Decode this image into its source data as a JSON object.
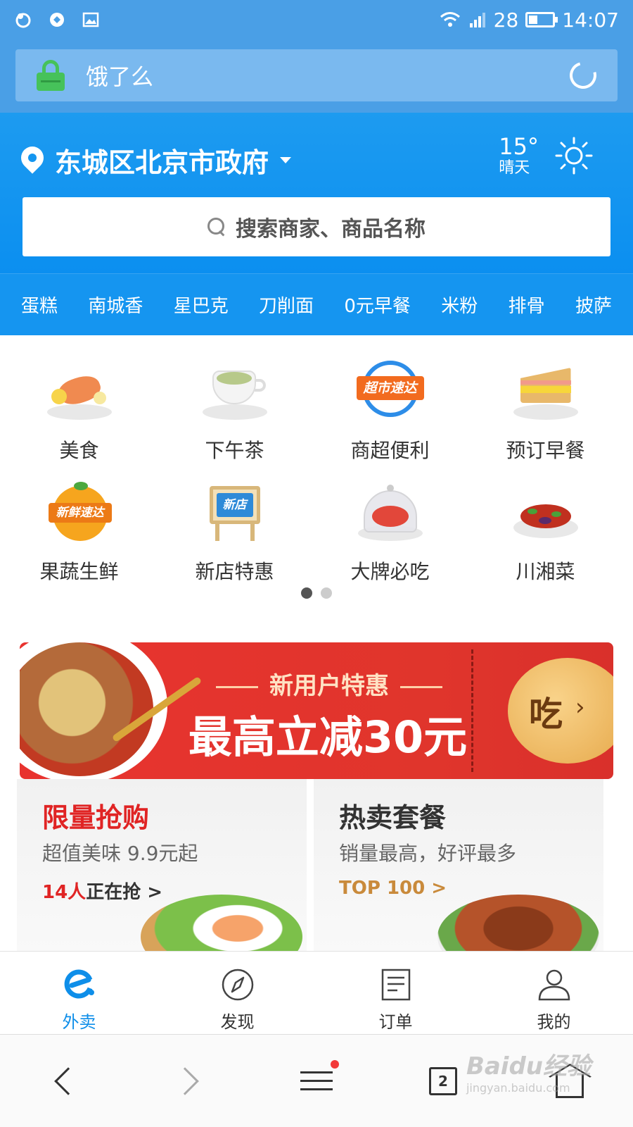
{
  "status_bar": {
    "signal_value": "28",
    "time": "14:07",
    "battery_level": 0.35
  },
  "browser": {
    "url_text": "饿了么",
    "tab_count": "2",
    "watermark": {
      "brand": "Baidu经验",
      "url": "jingyan.baidu.com"
    }
  },
  "header": {
    "location": "东城区北京市政府",
    "weather": {
      "temp": "15°",
      "condition": "晴天"
    },
    "search_placeholder": "搜索商家、商品名称",
    "hot_words": [
      "蛋糕",
      "南城香",
      "星巴克",
      "刀削面",
      "0元早餐",
      "米粉",
      "排骨",
      "披萨"
    ]
  },
  "categories": [
    {
      "label": "美食",
      "icon": "grilled-salmon-icon"
    },
    {
      "label": "下午茶",
      "icon": "latte-cup-icon"
    },
    {
      "label": "商超便利",
      "icon": "supermarket-express-icon",
      "badge": "超市速达"
    },
    {
      "label": "预订早餐",
      "icon": "sandwich-icon"
    },
    {
      "label": "果蔬生鲜",
      "icon": "orange-fresh-icon",
      "badge": "新鲜速达"
    },
    {
      "label": "新店特惠",
      "icon": "new-store-sign-icon",
      "badge": "新店"
    },
    {
      "label": "大牌必吃",
      "icon": "cloche-dish-icon"
    },
    {
      "label": "川湘菜",
      "icon": "spicy-dish-icon"
    }
  ],
  "pager": {
    "pages": 2,
    "current": 1
  },
  "promo_banner": {
    "subtitle": "新用户特惠",
    "headline": "最高立减30元",
    "cta": "吃"
  },
  "cards": [
    {
      "title": "限量抢购",
      "desc": "超值美味 9.9元起",
      "meta_highlight": "14人",
      "meta_text": "正在抢 >",
      "title_color": "#e02424"
    },
    {
      "title": "热卖套餐",
      "desc": "销量最高，好评最多",
      "meta_text": "TOP 100 >",
      "title_color": "#333333",
      "meta_color": "#c98a3b"
    }
  ],
  "tab_bar": [
    {
      "label": "外卖",
      "icon": "eleme-logo-icon",
      "active": true
    },
    {
      "label": "发现",
      "icon": "compass-icon",
      "active": false
    },
    {
      "label": "订单",
      "icon": "order-list-icon",
      "active": false
    },
    {
      "label": "我的",
      "icon": "user-profile-icon",
      "active": false
    }
  ],
  "colors": {
    "accent": "#0e8ee9",
    "header_blue": "#1595f0",
    "banner_red": "#e8332f"
  }
}
